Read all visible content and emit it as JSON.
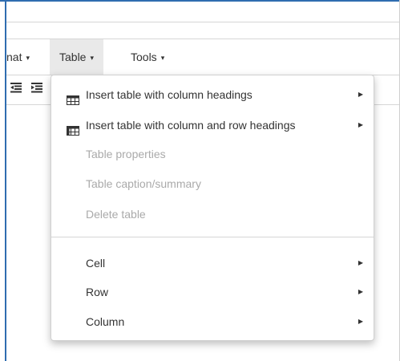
{
  "menubar": {
    "format_label": "nat",
    "table_label": "Table",
    "tools_label": "Tools",
    "caret": "▾"
  },
  "toolbar": {
    "outdent_icon": "outdent-icon",
    "indent_icon": "indent-icon"
  },
  "table_menu": {
    "items": [
      {
        "label": "Insert table with column headings",
        "icon": "table-grid-icon",
        "submenu": true,
        "disabled": false
      },
      {
        "label": "Insert table with column and row headings",
        "icon": "table-grid-icon",
        "submenu": true,
        "disabled": false
      },
      {
        "label": "Table properties",
        "disabled": true
      },
      {
        "label": "Table caption/summary",
        "disabled": true
      },
      {
        "label": "Delete table",
        "disabled": true
      },
      {
        "label": "Cell",
        "submenu": true,
        "disabled": false
      },
      {
        "label": "Row",
        "submenu": true,
        "disabled": false
      },
      {
        "label": "Column",
        "submenu": true,
        "disabled": false
      }
    ],
    "submenu_arrow": "▶"
  },
  "colors": {
    "frame_accent": "#2f6db0",
    "active_menu_bg": "#e9e9e9",
    "disabled_text": "#aaaaaa"
  }
}
